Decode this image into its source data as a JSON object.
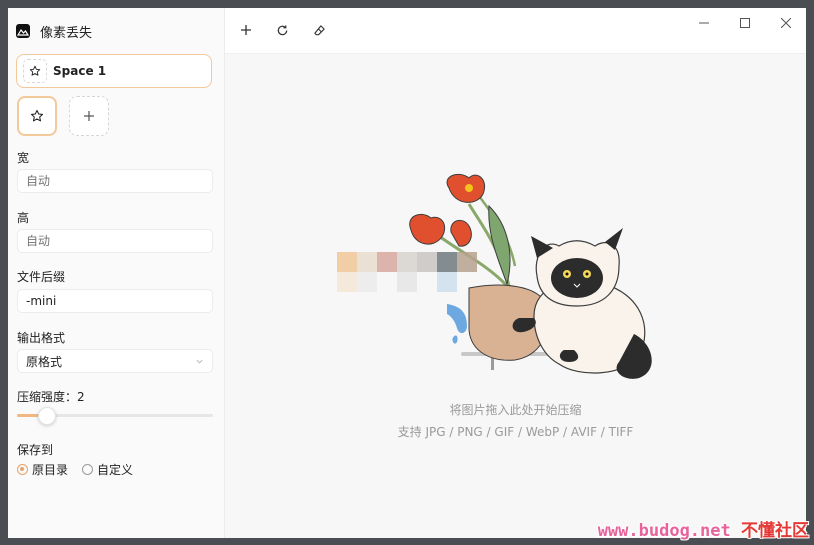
{
  "app": {
    "title": "像素丢失"
  },
  "space": {
    "name": "Space 1"
  },
  "fields": {
    "width": {
      "label": "宽",
      "placeholder": "自动"
    },
    "height": {
      "label": "高",
      "placeholder": "自动"
    },
    "suffix": {
      "label": "文件后缀",
      "value": "-mini"
    },
    "format": {
      "label": "输出格式",
      "value": "原格式"
    },
    "compression": {
      "label": "压缩强度：",
      "value": "2",
      "level_fraction": 0.15
    },
    "save_to": {
      "label": "保存到",
      "options": [
        "原目录",
        "自定义"
      ],
      "selected": 0
    }
  },
  "toolbar": {
    "add_icon": "plus-icon",
    "refresh_icon": "refresh-icon",
    "clear_icon": "eraser-icon"
  },
  "window_controls": [
    "minimize-icon",
    "maximize-icon",
    "close-icon"
  ],
  "drop_zone": {
    "line1": "将图片拖入此处开始压缩",
    "line2": "支持 JPG / PNG / GIF / WebP / AVIF / TIFF"
  },
  "watermark": {
    "latin": "www.budog.net",
    "cn": "不懂社区"
  },
  "colors": {
    "accent": "#f3c99a",
    "accent_strong": "#e9a26a"
  }
}
